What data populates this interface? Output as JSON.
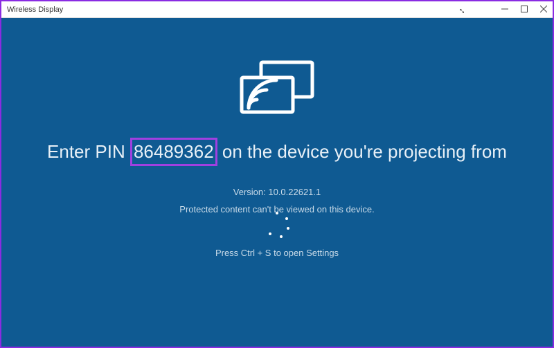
{
  "window": {
    "title": "Wireless Display"
  },
  "main": {
    "instruction_prefix": "Enter PIN ",
    "pin": "86489362",
    "instruction_suffix": " on the device you're projecting from",
    "version_label": "Version: 10.0.22621.1",
    "protected_label": "Protected content can't be viewed on this device.",
    "hint_label": "Press Ctrl + S to open Settings"
  },
  "colors": {
    "background": "#0f5a92",
    "highlight_border": "#a040e0"
  }
}
